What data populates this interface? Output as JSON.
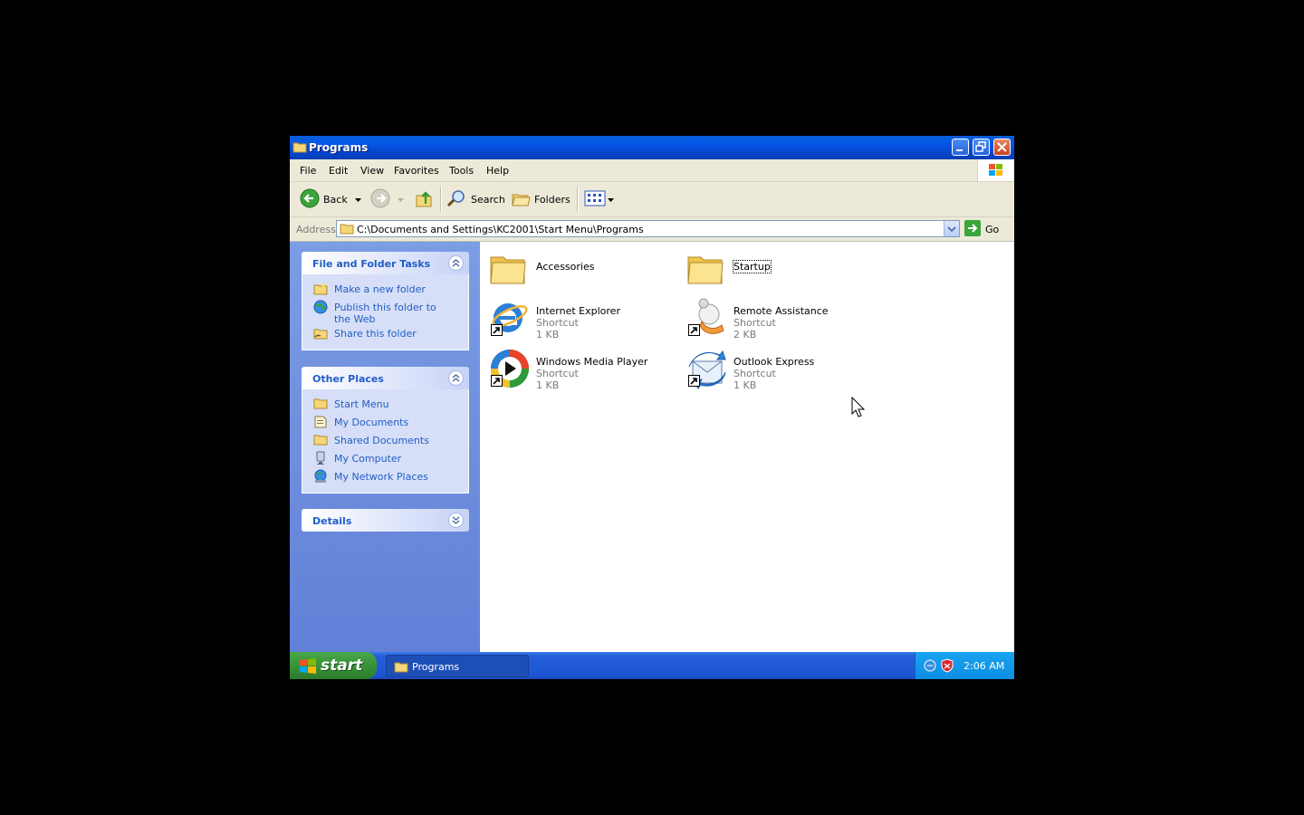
{
  "window": {
    "title": "Programs",
    "buttons": [
      "minimize",
      "restore",
      "close"
    ]
  },
  "menu": [
    "File",
    "Edit",
    "View",
    "Favorites",
    "Tools",
    "Help"
  ],
  "toolbar": {
    "back_label": "Back",
    "search_label": "Search",
    "folders_label": "Folders"
  },
  "address": {
    "label": "Address",
    "value": "C:\\Documents and Settings\\KC2001\\Start Menu\\Programs",
    "go_label": "Go"
  },
  "sidebar": {
    "file_tasks": {
      "title": "File and Folder Tasks",
      "items": [
        {
          "label": "Make a new folder",
          "icon": "new-folder-icon"
        },
        {
          "label": "Publish this folder to the Web",
          "icon": "globe-icon"
        },
        {
          "label": "Share this folder",
          "icon": "share-folder-icon"
        }
      ]
    },
    "other_places": {
      "title": "Other Places",
      "items": [
        {
          "label": "Start Menu",
          "icon": "folder-icon"
        },
        {
          "label": "My Documents",
          "icon": "documents-icon"
        },
        {
          "label": "Shared Documents",
          "icon": "folder-icon"
        },
        {
          "label": "My Computer",
          "icon": "computer-icon"
        },
        {
          "label": "My Network Places",
          "icon": "network-icon"
        }
      ]
    },
    "details": {
      "title": "Details"
    }
  },
  "files": [
    {
      "name": "Accessories",
      "type": "folder"
    },
    {
      "name": "Startup",
      "type": "folder",
      "focused": true
    },
    {
      "name": "Internet Explorer",
      "type": "Shortcut",
      "size": "1 KB",
      "icon": "internet-explorer-icon"
    },
    {
      "name": "Remote Assistance",
      "type": "Shortcut",
      "size": "2 KB",
      "icon": "remote-assistance-icon"
    },
    {
      "name": "Windows Media Player",
      "type": "Shortcut",
      "size": "1 KB",
      "icon": "media-player-icon"
    },
    {
      "name": "Outlook Express",
      "type": "Shortcut",
      "size": "1 KB",
      "icon": "outlook-express-icon"
    }
  ],
  "taskbar": {
    "start_label": "start",
    "task_label": "Programs",
    "clock": "2:06 AM"
  },
  "colors": {
    "titlebar": "#0658e8",
    "sidebar": "#6f8fdd",
    "link": "#215dc6",
    "start": "#3c963c",
    "taskbar": "#245edb"
  }
}
